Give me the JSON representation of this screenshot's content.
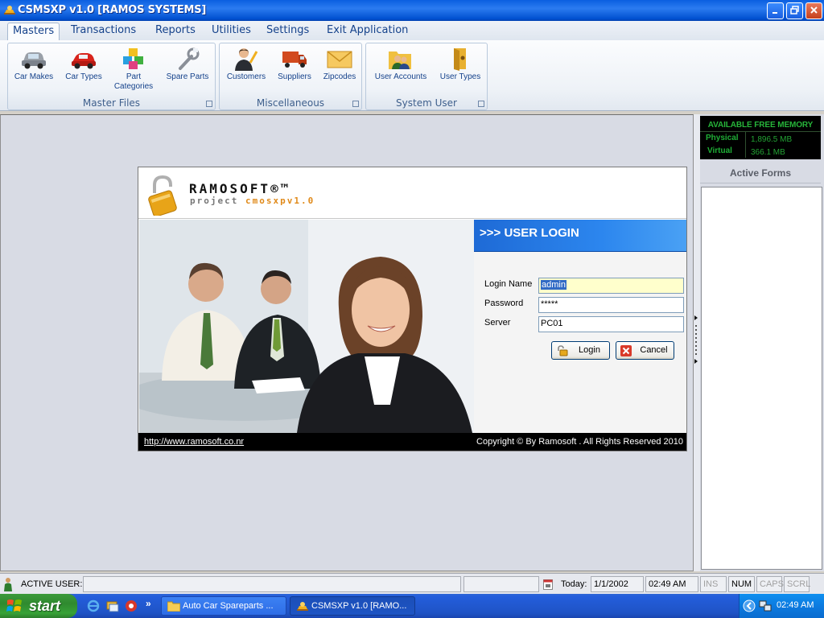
{
  "window": {
    "title": "CSMSXP v1.0 [RAMOS SYSTEMS]"
  },
  "ribbon": {
    "tabs": [
      "Masters",
      "Transactions",
      "Reports",
      "Utilities",
      "Settings",
      "Exit Application"
    ],
    "groups": [
      {
        "label": "Master Files",
        "buttons": [
          "Car Makes",
          "Car Types",
          "Part Categories",
          "Spare Parts"
        ]
      },
      {
        "label": "Miscellaneous",
        "buttons": [
          "Customers",
          "Suppliers",
          "Zipcodes"
        ]
      },
      {
        "label": "System User",
        "buttons": [
          "User Accounts",
          "User Types"
        ]
      }
    ]
  },
  "memory": {
    "title": "AVAILABLE FREE MEMORY",
    "physical_label": "Physical",
    "physical_value": "1,896.5 MB",
    "virtual_label": "Virtual",
    "virtual_value": "366.1 MB"
  },
  "active_forms": {
    "header": "Active Forms"
  },
  "login": {
    "brand": "RAMOSOFT®™",
    "brand_sub_prefix": "project ",
    "brand_sub_accent": "cmosxpv1.0",
    "band_title": ">>> USER LOGIN",
    "login_name_label": "Login Name",
    "login_name_value": "admin",
    "password_label": "Password",
    "password_value": "*****",
    "server_label": "Server",
    "server_value": "PC01",
    "login_button": "Login",
    "cancel_button": "Cancel",
    "footer_url": "http://www.ramosoft.co.nr",
    "footer_copyright": "Copyright © By Ramosoft . All Rights Reserved 2010"
  },
  "statusbar": {
    "active_user_label": "ACTIVE USER:",
    "today_label": "Today:",
    "date": "1/1/2002",
    "time": "02:49 AM",
    "ins": "INS",
    "num": "NUM",
    "caps": "CAPS",
    "scrl": "SCRL"
  },
  "taskbar": {
    "start": "start",
    "tasks": [
      "Auto Car Spareparts ...",
      "CSMSXP v1.0 [RAMO..."
    ],
    "clock": "02:49 AM",
    "overflow": "»"
  }
}
